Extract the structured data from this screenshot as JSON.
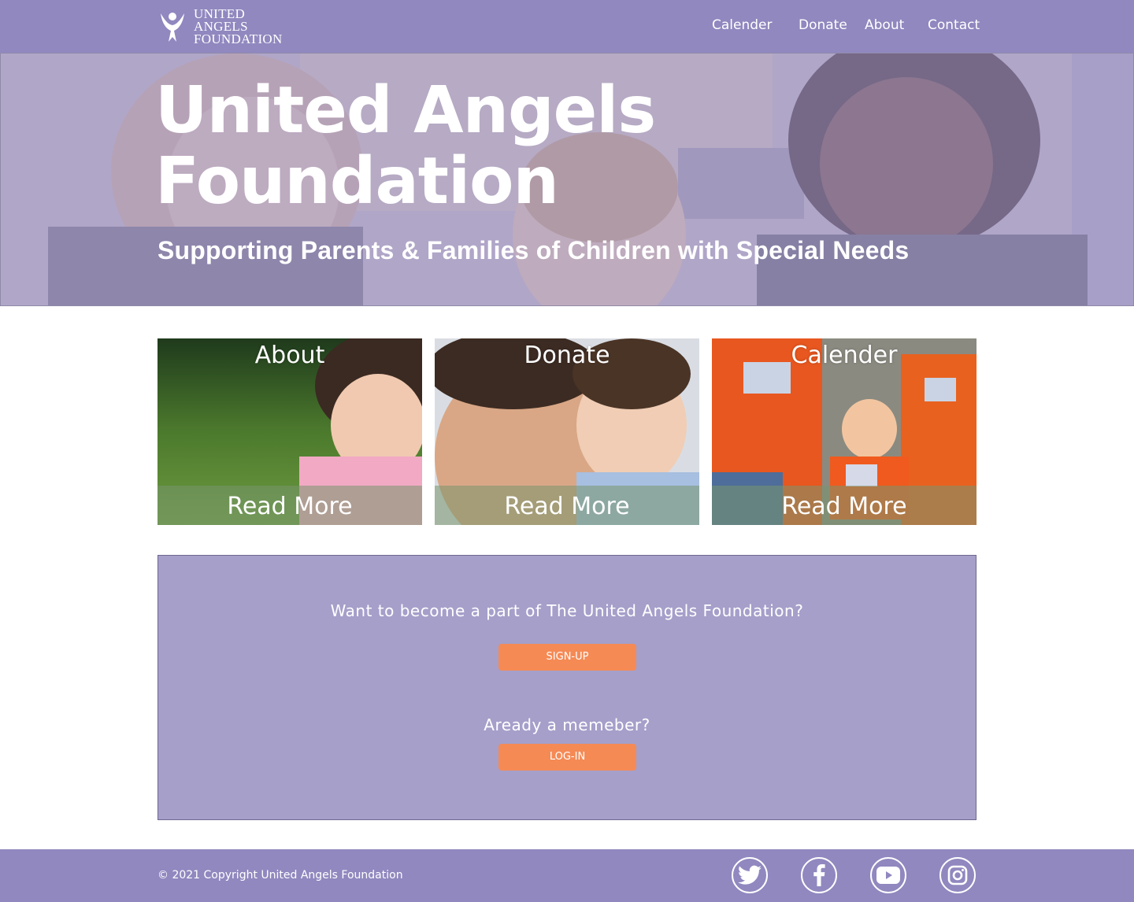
{
  "header": {
    "logo": {
      "line1": "UNITED ANGELS",
      "line2": "FOUNDATION"
    },
    "nav": [
      {
        "label": "Calender"
      },
      {
        "label": "Donate"
      },
      {
        "label": "About"
      },
      {
        "label": "Contact"
      }
    ]
  },
  "hero": {
    "title_line1": "United Angels",
    "title_line2": "Foundation",
    "subtitle": "Supporting Parents & Families of Children with Special Needs"
  },
  "cards": [
    {
      "title": "About",
      "link": "Read More"
    },
    {
      "title": "Donate",
      "link": "Read More"
    },
    {
      "title": "Calender",
      "link": "Read More"
    }
  ],
  "membership": {
    "question": "Want to become a part of The United Angels Foundation?",
    "signup_label": "SIGN-UP",
    "member_question": "Aready a memeber?",
    "login_label": "LOG-IN"
  },
  "footer": {
    "copyright": "© 2021 Copyright United Angels Foundation",
    "social": [
      "twitter-icon",
      "facebook-icon",
      "youtube-icon",
      "instagram-icon"
    ]
  },
  "colors": {
    "header_bg": "#9088bf",
    "panel_bg": "#a59fca",
    "button_bg": "#f58a55"
  }
}
